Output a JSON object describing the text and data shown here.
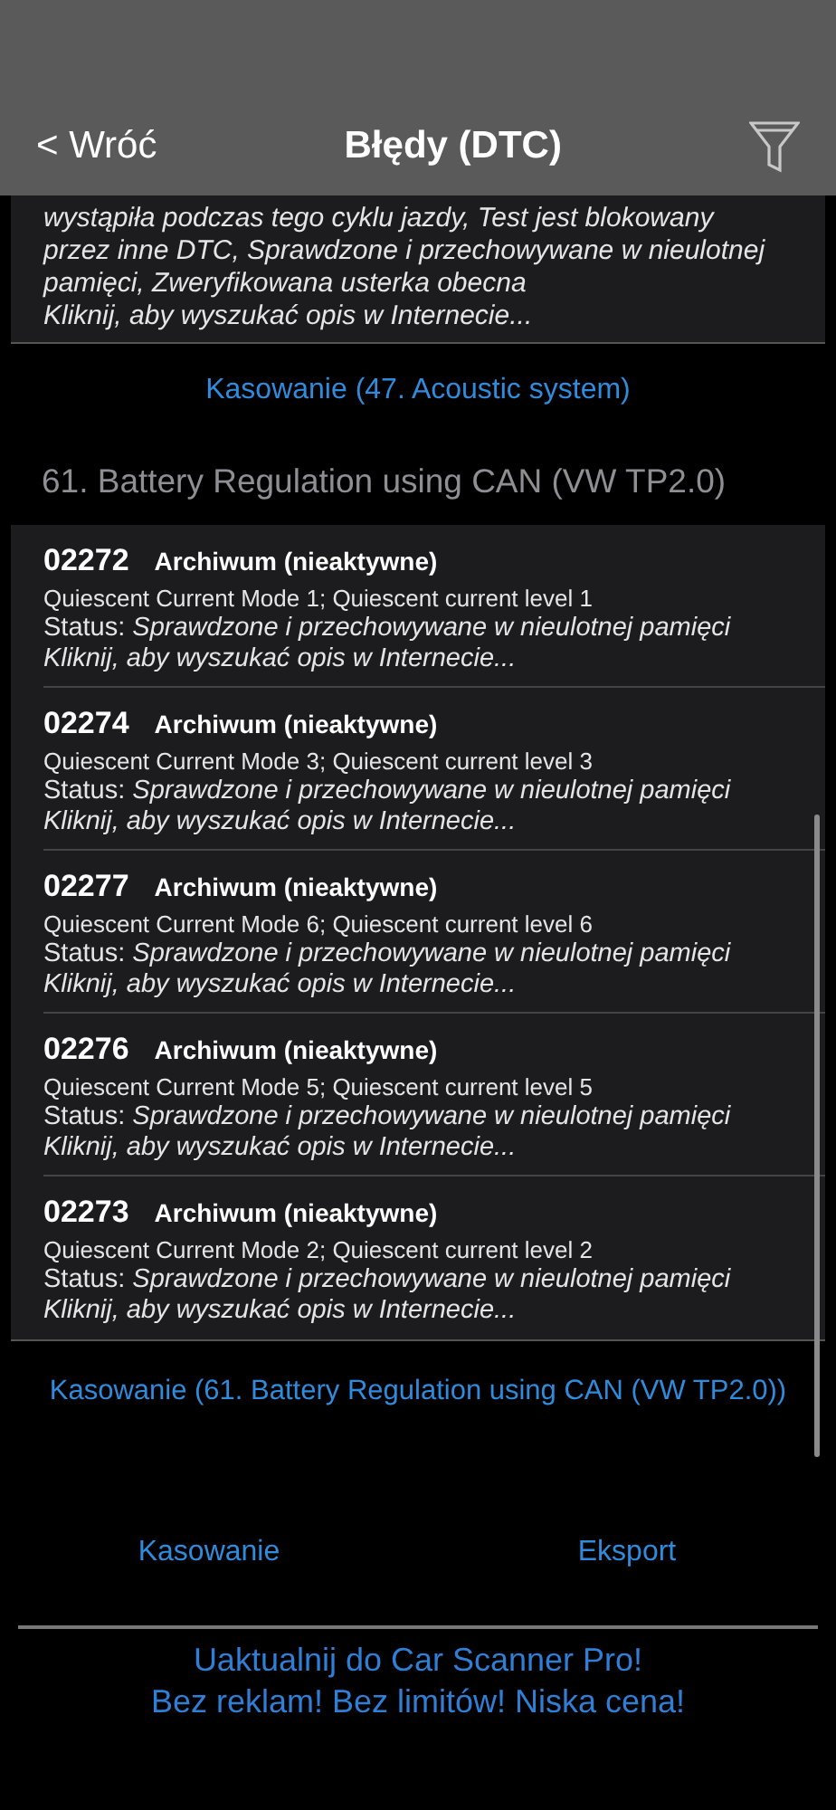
{
  "nav": {
    "back": "< Wróć",
    "title": "Błędy (DTC)"
  },
  "previous_section": {
    "status_text": "wystąpiła podczas tego cyklu jazdy, Test jest blokowany przez inne DTC, Sprawdzone i przechowywane w nieulotnej pamięci, Zweryfikowana usterka obecna",
    "link": "Kliknij, aby wyszukać opis w Internecie...",
    "clear_button": "Kasowanie (47. Acoustic system)"
  },
  "section": {
    "title": "61. Battery Regulation using CAN (VW TP2.0)",
    "errors": [
      {
        "code": "02272",
        "state": "Archiwum (nieaktywne)",
        "description": "Quiescent Current Mode 1; Quiescent current level 1",
        "status": "Status: *Sprawdzone i przechowywane w nieulotnej pamięci*",
        "link": "Kliknij, aby wyszukać opis w Internecie..."
      },
      {
        "code": "02274",
        "state": "Archiwum (nieaktywne)",
        "description": "Quiescent Current Mode 3; Quiescent current level 3",
        "status": "Status: *Sprawdzone i przechowywane w nieulotnej pamięci*",
        "link": "Kliknij, aby wyszukać opis w Internecie..."
      },
      {
        "code": "02277",
        "state": "Archiwum (nieaktywne)",
        "description": "Quiescent Current Mode 6; Quiescent current level 6",
        "status": "Status: *Sprawdzone i przechowywane w nieulotnej pamięci*",
        "link": "Kliknij, aby wyszukać opis w Internecie..."
      },
      {
        "code": "02276",
        "state": "Archiwum (nieaktywne)",
        "description": "Quiescent Current Mode 5; Quiescent current level 5",
        "status": "Status: *Sprawdzone i przechowywane w nieulotnej pamięci*",
        "link": "Kliknij, aby wyszukać opis w Internecie..."
      },
      {
        "code": "02273",
        "state": "Archiwum (nieaktywne)",
        "description": "Quiescent Current Mode 2; Quiescent current level 2",
        "status": "Status: *Sprawdzone i przechowywane w nieulotnej pamięci*",
        "link": "Kliknij, aby wyszukać opis w Internecie..."
      }
    ],
    "clear_button": "Kasowanie (61. Battery Regulation using CAN (VW TP2.0))"
  },
  "actions": [
    "Kasowanie",
    "Eksport"
  ],
  "promo": [
    "Uaktualnij do Car Scanner Pro!",
    "Bez reklam! Bez limitów! Niska cena!"
  ]
}
